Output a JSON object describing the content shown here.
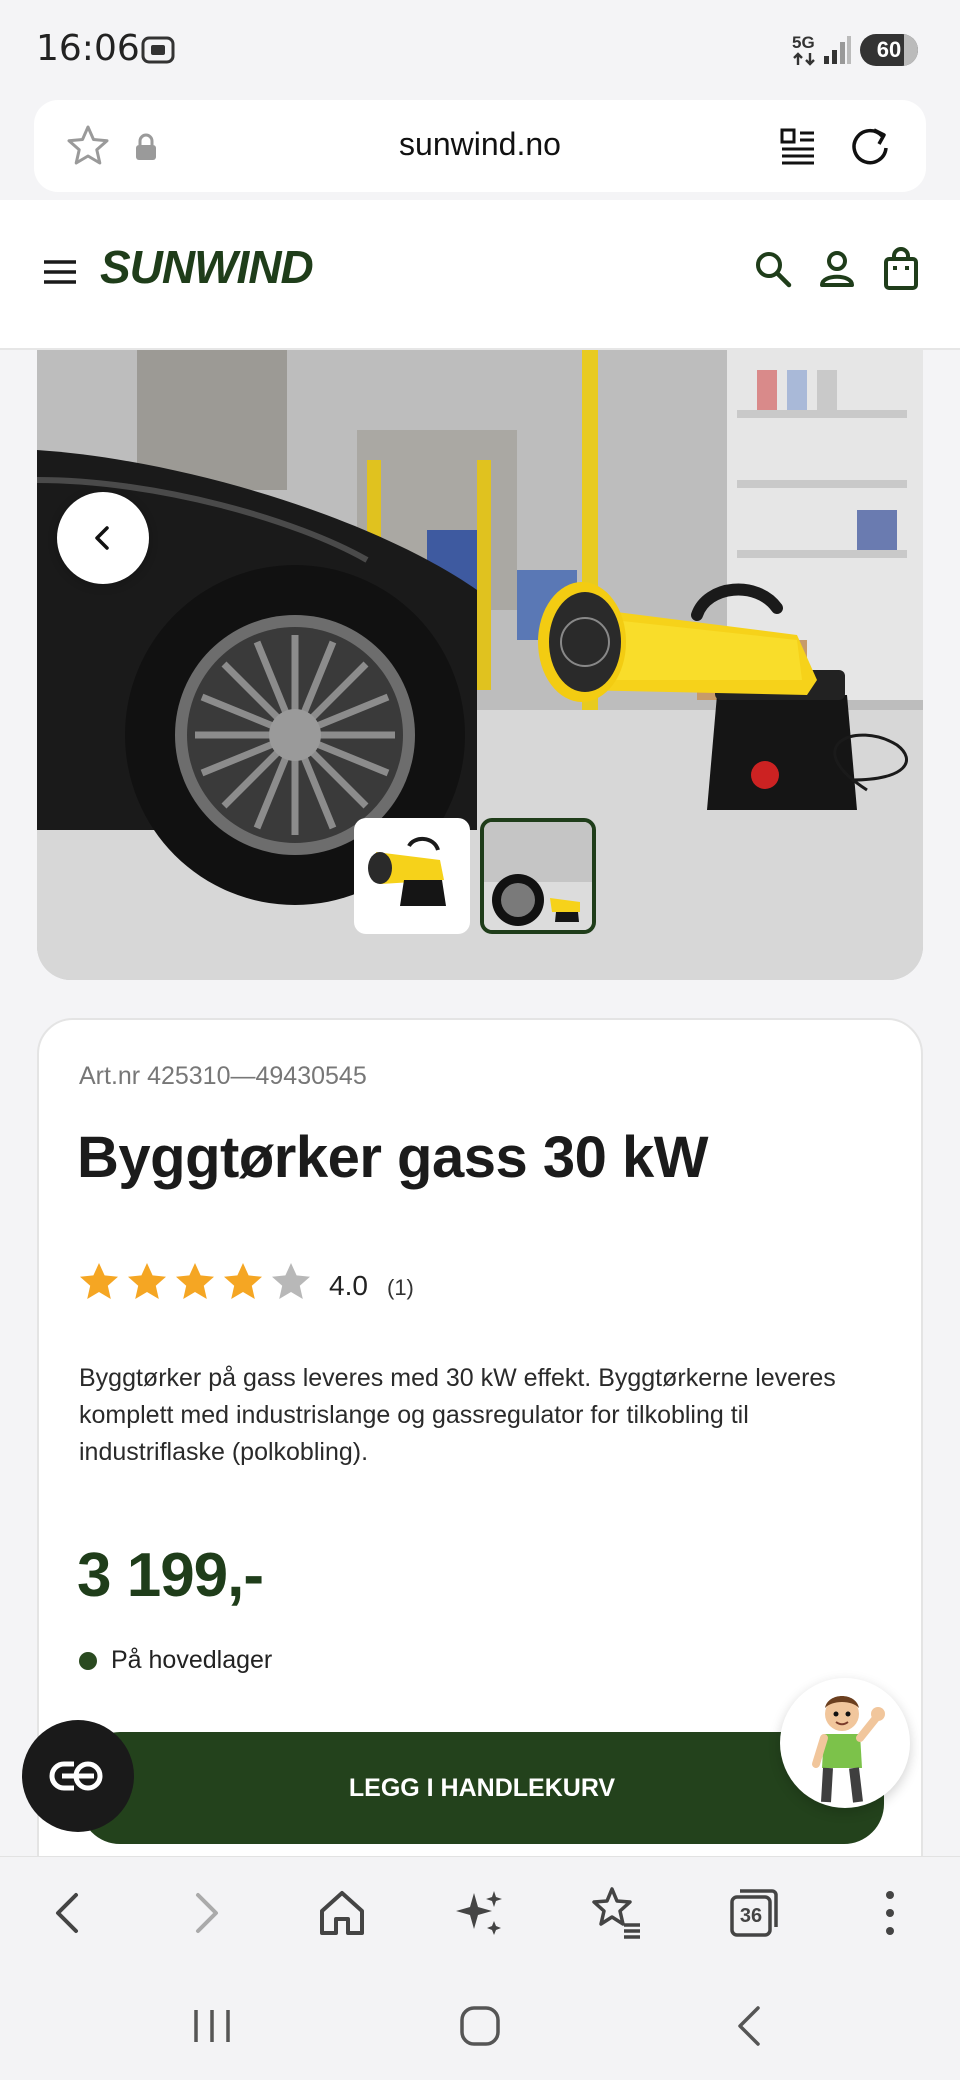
{
  "status_bar": {
    "time": "16:06",
    "network": "5G",
    "battery": "60"
  },
  "browser": {
    "url": "sunwind.no",
    "tab_count": "36"
  },
  "site": {
    "logo_text": "SUNWIND"
  },
  "product": {
    "art_nr": "Art.nr 425310—49430545",
    "title": "Byggtørker gass 30 kW",
    "rating": "4.0",
    "rating_value": 4,
    "rating_max": 5,
    "review_count": "(1)",
    "description": "Byggtørker på gass leveres med 30 kW effekt. Byggtørkerne leveres komplett med industrislange og gassregulator for tilkobling til industriflaske (polkobling).",
    "price": "3 199,-",
    "stock_status": "På hovedlager",
    "add_to_cart_label": "LEGG I HANDLEKURV"
  },
  "gallery": {
    "thumbnails": [
      "product-thumbnail",
      "garage-thumbnail"
    ],
    "selected_index": 1
  },
  "colors": {
    "brand_green": "#1f3d1a",
    "star_filled": "#f5a623",
    "star_empty": "#b8b8b8",
    "heater_yellow": "#f6d21a"
  }
}
